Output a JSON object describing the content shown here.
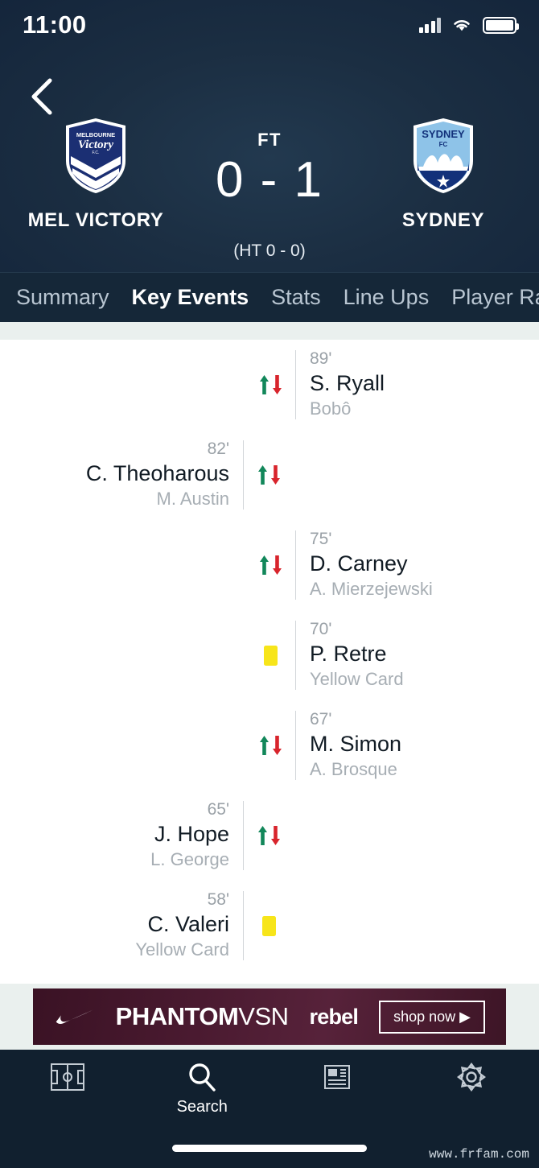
{
  "status_bar": {
    "time": "11:00",
    "signal_icon": "signal-bars-icon",
    "wifi_icon": "wifi-icon",
    "battery_icon": "battery-full-icon"
  },
  "header": {
    "back_icon": "chevron-left-icon",
    "home_team": {
      "name": "MEL VICTORY",
      "crest": "melbourne-victory-crest",
      "crest_line1": "MELBOURNE",
      "crest_line2": "Victory",
      "crest_line3": "F.C."
    },
    "away_team": {
      "name": "SYDNEY",
      "crest": "sydney-fc-crest",
      "crest_line1": "SYDNEY",
      "crest_line2": "FC"
    },
    "status": "FT",
    "score": "0 - 1",
    "halftime": "(HT 0 - 0)"
  },
  "tabs": [
    {
      "label": "Summary",
      "active": false
    },
    {
      "label": "Key Events",
      "active": true
    },
    {
      "label": "Stats",
      "active": false
    },
    {
      "label": "Line Ups",
      "active": false
    },
    {
      "label": "Player Rati",
      "active": false
    }
  ],
  "events": [
    {
      "side": "right",
      "minute": "89'",
      "player": "S. Ryall",
      "detail": "Bobô",
      "icon": "substitution-icon"
    },
    {
      "side": "left",
      "minute": "82'",
      "player": "C. Theoharous",
      "detail": "M. Austin",
      "icon": "substitution-icon"
    },
    {
      "side": "right",
      "minute": "75'",
      "player": "D. Carney",
      "detail": "A. Mierzejewski",
      "icon": "substitution-icon"
    },
    {
      "side": "right",
      "minute": "70'",
      "player": "P. Retre",
      "detail": "Yellow Card",
      "icon": "yellow-card-icon"
    },
    {
      "side": "right",
      "minute": "67'",
      "player": "M. Simon",
      "detail": "A. Brosque",
      "icon": "substitution-icon"
    },
    {
      "side": "left",
      "minute": "65'",
      "player": "J. Hope",
      "detail": "L. George",
      "icon": "substitution-icon"
    },
    {
      "side": "left",
      "minute": "58'",
      "player": "C. Valeri",
      "detail": "Yellow Card",
      "icon": "yellow-card-icon"
    }
  ],
  "ad": {
    "brand_icon": "nike-swoosh-icon",
    "product": "PHANTOM",
    "product_suffix": "VSN",
    "retailer": "rebel",
    "cta": "shop now ▶"
  },
  "bottom_nav": [
    {
      "label": "",
      "icon": "football-pitch-icon",
      "active": false
    },
    {
      "label": "Search",
      "icon": "search-icon",
      "active": true
    },
    {
      "label": "",
      "icon": "news-icon",
      "active": false
    },
    {
      "label": "",
      "icon": "gear-icon",
      "active": false
    }
  ],
  "watermark": "www.frfam.com",
  "colors": {
    "header_bg": "#16293d",
    "tab_bg": "#152738",
    "sub_in": "#12875a",
    "sub_out": "#d8242c",
    "yellow_card": "#f7e51a",
    "ad_bg": "#4a1a30"
  }
}
